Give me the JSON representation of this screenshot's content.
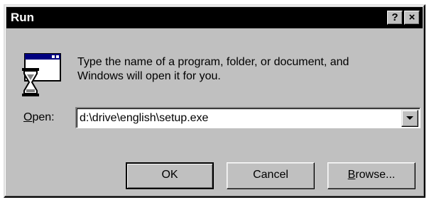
{
  "window": {
    "title": "Run",
    "help_button": "?",
    "close_button": "×"
  },
  "dialog": {
    "message_line1": "Type the name of a program, folder, or document, and",
    "message_line2": "Windows will open it for you.",
    "open_label_accel": "O",
    "open_label_rest": "pen:",
    "open_value": "d:\\drive\\english\\setup.exe",
    "icon": "run-program-hourglass-icon"
  },
  "buttons": {
    "ok": "OK",
    "cancel": "Cancel",
    "browse_accel": "B",
    "browse_rest": "rowse..."
  },
  "colors": {
    "face": "#c0c0c0",
    "titlebar": "#000000",
    "title_text": "#ffffff"
  }
}
